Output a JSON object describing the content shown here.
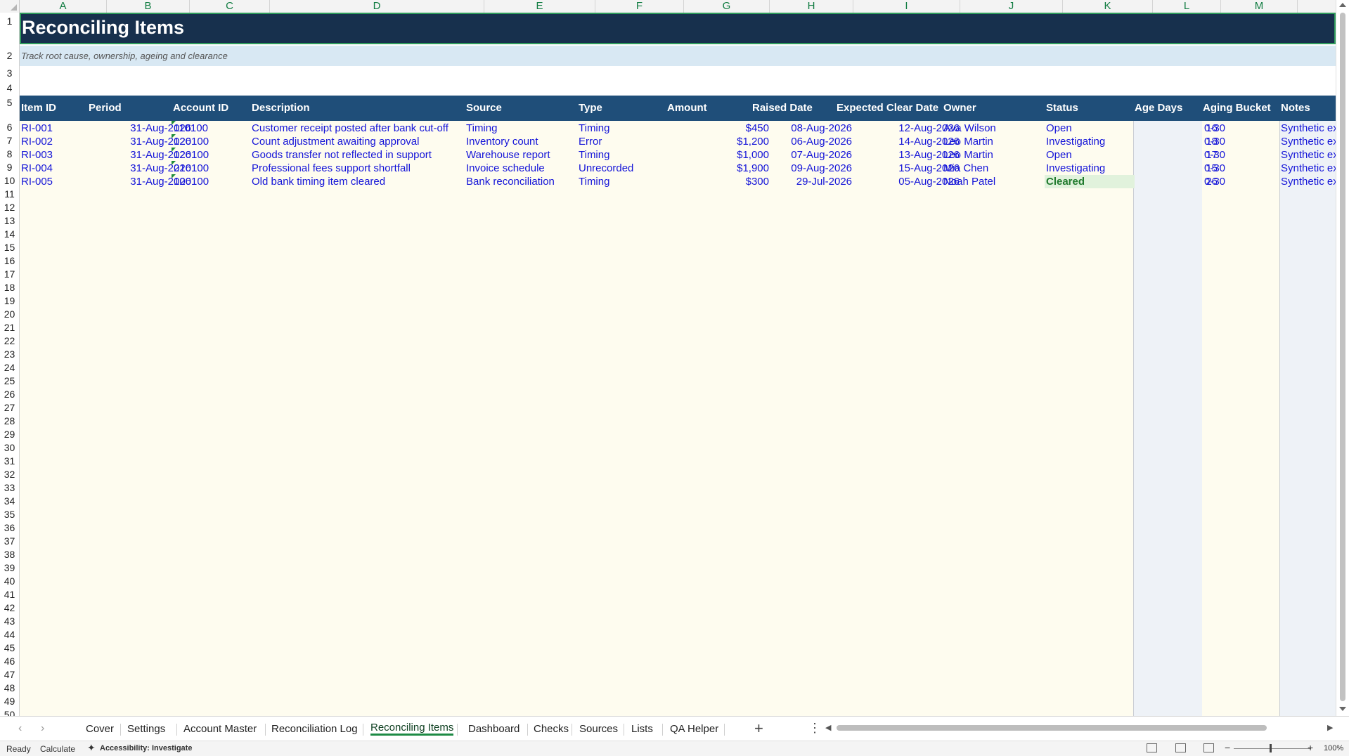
{
  "columns": [
    "A",
    "B",
    "C",
    "D",
    "E",
    "F",
    "G",
    "H",
    "I",
    "J",
    "K",
    "L",
    "M"
  ],
  "rows": [
    "1",
    "2",
    "3",
    "4",
    "5",
    "6",
    "7",
    "8",
    "9",
    "10",
    "11",
    "12",
    "13",
    "14",
    "15",
    "16",
    "17",
    "18",
    "19",
    "20",
    "21",
    "22",
    "23",
    "24",
    "25",
    "26",
    "27",
    "28",
    "29",
    "30",
    "31",
    "32",
    "33",
    "34",
    "35",
    "36",
    "37",
    "38",
    "39",
    "40",
    "41",
    "42",
    "43",
    "44",
    "45",
    "46",
    "47",
    "48",
    "49",
    "50"
  ],
  "sheet": {
    "title": "Reconciling Items",
    "subtitle": "Track root cause, ownership, ageing and clearance"
  },
  "headers": [
    "Item ID",
    "Period",
    "Account ID",
    "Description",
    "Source",
    "Type",
    "Amount",
    "Raised Date",
    "Expected Clear Date",
    "Owner",
    "Status",
    "Age Days",
    "Aging Bucket",
    "Notes"
  ],
  "items": [
    {
      "id": "RI-001",
      "period": "31-Aug-2026",
      "account": "110100",
      "description": "Customer receipt posted after bank cut-off",
      "source": "Timing",
      "type": "Timing",
      "amount": "$450",
      "raised": "08-Aug-2026",
      "expected": "12-Aug-2026",
      "owner": "Ava Wilson",
      "status": "Open",
      "age": "16",
      "bucket": "0-30",
      "notes": "Synthetic example"
    },
    {
      "id": "RI-002",
      "period": "31-Aug-2026",
      "account": "120100",
      "description": "Count adjustment awaiting approval",
      "source": "Inventory count",
      "type": "Error",
      "amount": "$1,200",
      "raised": "06-Aug-2026",
      "expected": "14-Aug-2026",
      "owner": "Leo Martin",
      "status": "Investigating",
      "age": "18",
      "bucket": "0-30",
      "notes": "Synthetic example"
    },
    {
      "id": "RI-003",
      "period": "31-Aug-2026",
      "account": "120100",
      "description": "Goods transfer not reflected in support",
      "source": "Warehouse report",
      "type": "Timing",
      "amount": "$1,000",
      "raised": "07-Aug-2026",
      "expected": "13-Aug-2026",
      "owner": "Leo Martin",
      "status": "Open",
      "age": "17",
      "bucket": "0-30",
      "notes": "Synthetic example"
    },
    {
      "id": "RI-004",
      "period": "31-Aug-2026",
      "account": "210100",
      "description": "Professional fees support shortfall",
      "source": "Invoice schedule",
      "type": "Unrecorded",
      "amount": "$1,900",
      "raised": "09-Aug-2026",
      "expected": "15-Aug-2026",
      "owner": "Mia Chen",
      "status": "Investigating",
      "age": "15",
      "bucket": "0-30",
      "notes": "Synthetic example"
    },
    {
      "id": "RI-005",
      "period": "31-Aug-2026",
      "account": "100100",
      "description": "Old bank timing item cleared",
      "source": "Bank reconciliation",
      "type": "Timing",
      "amount": "$300",
      "raised": "29-Jul-2026",
      "expected": "05-Aug-2026",
      "owner": "Noah Patel",
      "status": "Cleared",
      "age": "26",
      "bucket": "0-30",
      "notes": "Synthetic example"
    }
  ],
  "tabs": [
    {
      "label": "Cover"
    },
    {
      "label": "Settings"
    },
    {
      "label": "Account Master"
    },
    {
      "label": "Reconciliation Log"
    },
    {
      "label": "Reconciling Items",
      "active": true
    },
    {
      "label": "Dashboard"
    },
    {
      "label": "Checks"
    },
    {
      "label": "Sources"
    },
    {
      "label": "Lists"
    },
    {
      "label": "QA Helper"
    }
  ],
  "tab_add_label": "+",
  "tab_more_label": "⋮",
  "status": {
    "ready": "Ready",
    "calculate": "Calculate",
    "accessibility": "Accessibility: Investigate",
    "zoom": "100%",
    "zoom_out": "−",
    "zoom_in": "+"
  },
  "colors": {
    "title_bg": "#17304d",
    "header_bg": "#1f4e79",
    "data_text": "#1414d8",
    "cleared_bg": "#e1f2dc",
    "cleared_text": "#1f7a2c",
    "accent": "#107c41"
  }
}
